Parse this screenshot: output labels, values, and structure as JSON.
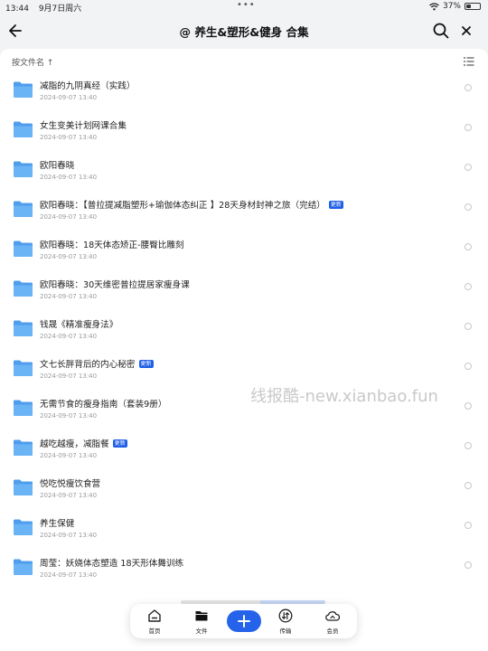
{
  "status_bar": {
    "time": "13:44",
    "date": "9月7日周六",
    "battery_text": "37%",
    "battery_level": 0.37
  },
  "header": {
    "title": "@ 养生&塑形&健身 合集"
  },
  "toolbar": {
    "sort_label": "按文件名 ↑"
  },
  "files": [
    {
      "name": "减脂的九阴真经（实践）",
      "date": "2024-09-07 13:40",
      "badge": ""
    },
    {
      "name": "女生变美计划网课合集",
      "date": "2024-09-07 13:40",
      "badge": ""
    },
    {
      "name": "欧阳春晓",
      "date": "2024-09-07 13:40",
      "badge": ""
    },
    {
      "name": "欧阳春晓：【普拉提减脂塑形+瑜伽体态纠正 】28天身材封神之旅（完结）",
      "date": "2024-09-07 13:40",
      "badge": "更新"
    },
    {
      "name": "欧阳春晓：18天体态矫正-腰臀比雕刻",
      "date": "2024-09-07 13:40",
      "badge": ""
    },
    {
      "name": "欧阳春晓：30天维密普拉提居家瘦身课",
      "date": "2024-09-07 13:40",
      "badge": ""
    },
    {
      "name": "钱晟《精准瘦身法》",
      "date": "2024-09-07 13:40",
      "badge": ""
    },
    {
      "name": "文七长胖背后的内心秘密",
      "date": "2024-09-07 13:40",
      "badge": "更新"
    },
    {
      "name": "无需节食的瘦身指南（套装9册）",
      "date": "2024-09-07 13:40",
      "badge": ""
    },
    {
      "name": "越吃越瘦，减脂餐",
      "date": "2024-09-07 13:40",
      "badge": "更新"
    },
    {
      "name": "悦吃悦瘦饮食营",
      "date": "2024-09-07 13:40",
      "badge": ""
    },
    {
      "name": "养生保健",
      "date": "2024-09-07 13:40",
      "badge": ""
    },
    {
      "name": "周莹：妖娆体态塑造 18天形体舞训练",
      "date": "2024-09-07 13:40",
      "badge": ""
    }
  ],
  "watermark": "线报酷-new.xianbao.fun",
  "tabbar": {
    "home": "首页",
    "files": "文件",
    "transfer": "传输",
    "member": "会员"
  },
  "colors": {
    "accent": "#2563eb",
    "folder": "#5aa9f0",
    "badge": "#1f5fe6"
  },
  "icons": [
    "back-arrow-icon",
    "search-icon",
    "close-icon",
    "list-view-icon",
    "folder-icon",
    "home-icon",
    "folder-tab-icon",
    "plus-icon",
    "transfer-icon",
    "cloud-member-icon"
  ]
}
